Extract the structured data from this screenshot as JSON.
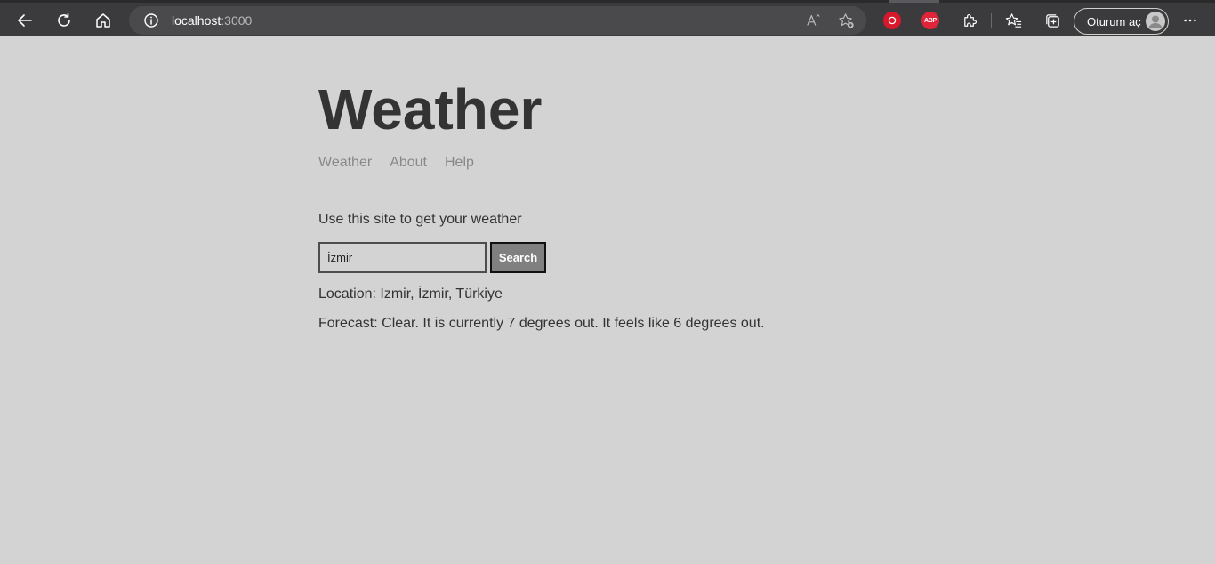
{
  "browser": {
    "url_host": "localhost",
    "url_port": ":3000",
    "signin_label": "Oturum aç",
    "extension_abp_label": "ABP"
  },
  "page": {
    "title": "Weather",
    "nav": [
      {
        "label": "Weather"
      },
      {
        "label": "About"
      },
      {
        "label": "Help"
      }
    ],
    "intro": "Use this site to get your weather",
    "search": {
      "value": "İzmir",
      "button_label": "Search"
    },
    "location": "Location: Izmir, İzmir, Türkiye",
    "forecast": "Forecast: Clear. It is currently 7 degrees out. It feels like 6 degrees out."
  },
  "colors": {
    "page_bg": "#d3d3d3",
    "chrome_bg": "#3b3b3d",
    "title_text": "#333333",
    "nav_text": "#888888",
    "button_bg": "#808080"
  },
  "icons": {
    "back": "back-arrow-icon",
    "refresh": "refresh-icon",
    "home": "home-icon",
    "info": "info-icon",
    "read_aloud": "read-aloud-icon",
    "add_favorite": "add-favorite-icon",
    "extensions": "puzzle-icon",
    "favorites": "favorites-icon",
    "collections": "collections-icon",
    "profile": "avatar-icon",
    "more": "more-icon"
  }
}
